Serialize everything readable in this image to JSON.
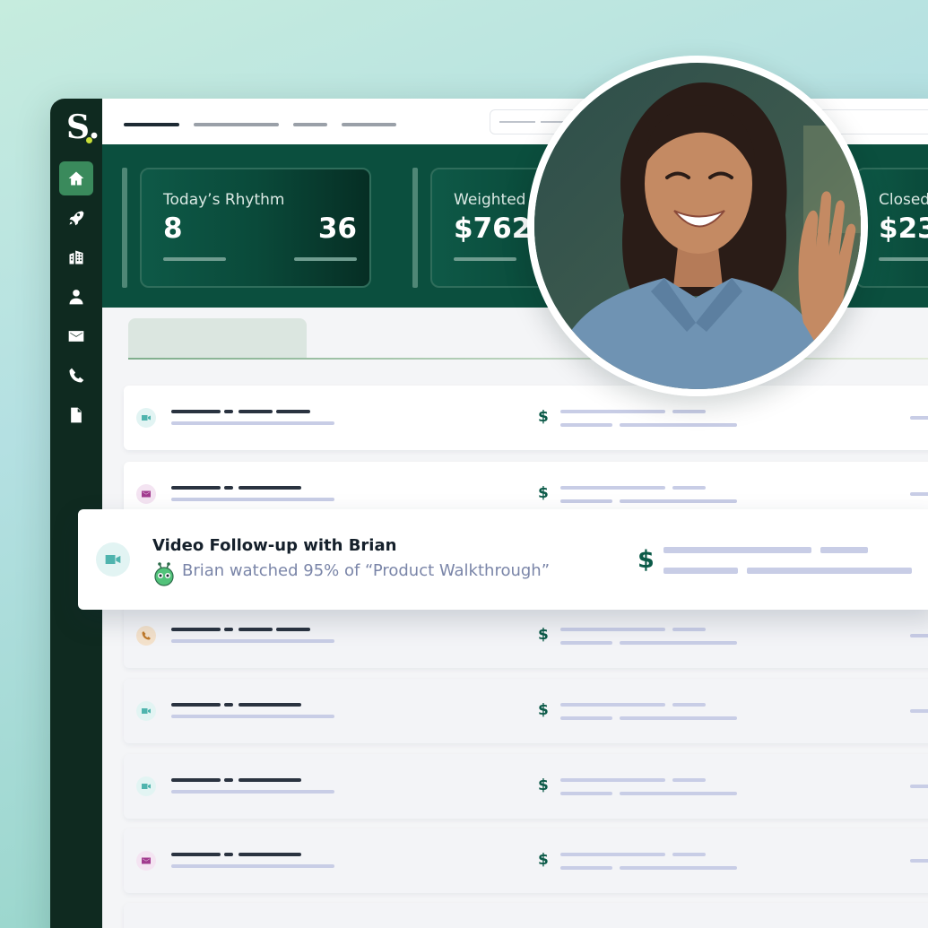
{
  "app": {
    "logo_letter": "S.",
    "colors": {
      "brand_dark": "#0f2a20",
      "hero": "#0b4f3e",
      "accent_active": "#3a8a5c",
      "logo_dot": "#c9e03a",
      "dollar": "#0b5a48"
    }
  },
  "sidebar": {
    "items": [
      {
        "name": "home",
        "icon": "home-icon",
        "active": true
      },
      {
        "name": "rocket",
        "icon": "rocket-icon",
        "active": false
      },
      {
        "name": "companies",
        "icon": "building-icon",
        "active": false
      },
      {
        "name": "contacts",
        "icon": "person-icon",
        "active": false
      },
      {
        "name": "email",
        "icon": "envelope-icon",
        "active": false
      },
      {
        "name": "calls",
        "icon": "phone-icon",
        "active": false
      },
      {
        "name": "documents",
        "icon": "document-icon",
        "active": false
      }
    ]
  },
  "stats": [
    {
      "label": "Today’s Rhythm",
      "value_left": "8",
      "value_right": "36"
    },
    {
      "label": "Weighted",
      "value": "$762"
    },
    {
      "label": "Closed",
      "value": "$23"
    }
  ],
  "highlight": {
    "title": "Video Follow-up with Brian",
    "subtitle": "Brian watched 95% of “Product Walkthrough”",
    "icon": "video-camera-icon",
    "dollar": "$"
  },
  "rows": [
    {
      "icon": "video-camera-icon",
      "dollar": "$"
    },
    {
      "icon": "envelope-icon",
      "dollar": "$"
    },
    {
      "icon": "phone-icon",
      "dollar": "$"
    },
    {
      "icon": "video-camera-icon",
      "dollar": "$"
    },
    {
      "icon": "video-camera-icon",
      "dollar": "$"
    },
    {
      "icon": "envelope-icon",
      "dollar": "$"
    }
  ],
  "avatar": {
    "icon": "person-photo"
  }
}
